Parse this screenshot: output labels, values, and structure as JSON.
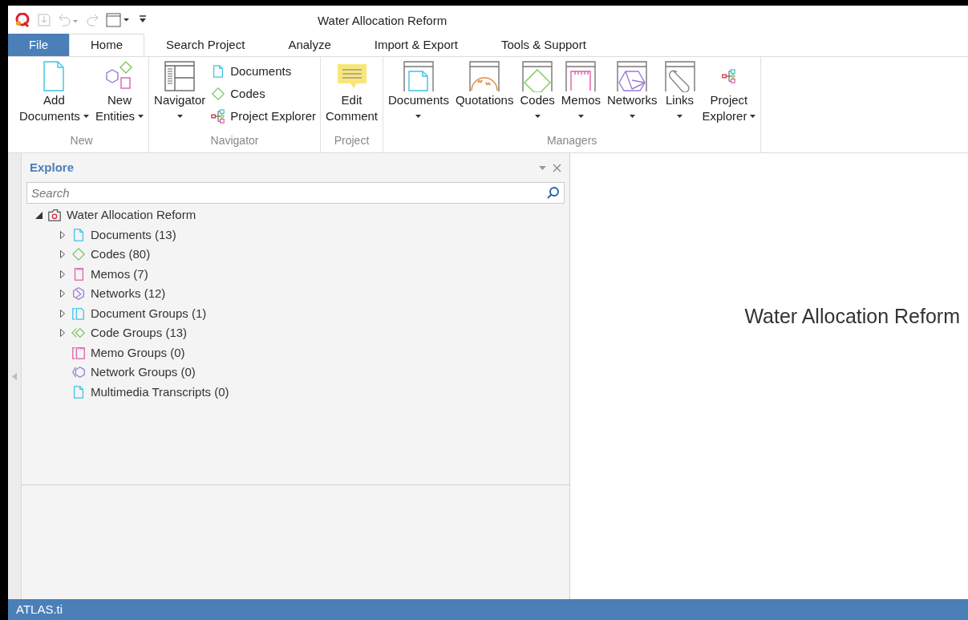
{
  "window": {
    "title": "Water Allocation Reform"
  },
  "tabs": [
    {
      "label": "File",
      "kind": "file",
      "selected": false
    },
    {
      "label": "Home",
      "kind": "tab",
      "selected": true
    },
    {
      "label": "Search Project",
      "kind": "tab",
      "selected": false
    },
    {
      "label": "Analyze",
      "kind": "tab",
      "selected": false
    },
    {
      "label": "Import & Export",
      "kind": "tab",
      "selected": false
    },
    {
      "label": "Tools & Support",
      "kind": "tab",
      "selected": false
    }
  ],
  "ribbon_groups": [
    {
      "name": "New",
      "buttons": [
        {
          "kind": "document",
          "lines": [
            "Add",
            "Documents"
          ],
          "dropdown": true
        },
        {
          "kind": "entities",
          "lines": [
            "New",
            "Entities"
          ],
          "dropdown": true
        }
      ]
    },
    {
      "name": "Navigator",
      "buttons": [
        {
          "kind": "navigator",
          "lines": [
            "Navigator"
          ],
          "dropdown": true
        },
        {
          "kind": "stack",
          "items": [
            {
              "kind": "document",
              "label": "Documents"
            },
            {
              "kind": "code",
              "label": "Codes"
            },
            {
              "kind": "explorer",
              "label": "Project Explorer"
            }
          ]
        }
      ]
    },
    {
      "name": "Project",
      "buttons": [
        {
          "kind": "comment",
          "lines": [
            "Edit",
            "Comment"
          ],
          "dropdown": false
        }
      ]
    },
    {
      "name": "Managers",
      "buttons": [
        {
          "kind": "mgr-document",
          "lines": [
            "Documents"
          ],
          "dropdown": true
        },
        {
          "kind": "mgr-quotation",
          "lines": [
            "Quotations"
          ],
          "dropdown": false
        },
        {
          "kind": "mgr-code",
          "lines": [
            "Codes"
          ],
          "dropdown": true
        },
        {
          "kind": "mgr-memo",
          "lines": [
            "Memos"
          ],
          "dropdown": true
        },
        {
          "kind": "mgr-network",
          "lines": [
            "Networks"
          ],
          "dropdown": true
        },
        {
          "kind": "mgr-link",
          "lines": [
            "Links"
          ],
          "dropdown": true
        },
        {
          "kind": "explorer",
          "lines": [
            "Project",
            "Explorer"
          ],
          "dropdown": true
        }
      ]
    }
  ],
  "explore": {
    "title": "Explore",
    "search": {
      "placeholder": "Search"
    },
    "tree": [
      {
        "label": "Water Allocation Reform",
        "kind": "project",
        "expandable": true,
        "expanded": true,
        "children": [
          {
            "label": "Documents (13)",
            "kind": "document",
            "expandable": true,
            "expanded": false
          },
          {
            "label": "Codes (80)",
            "kind": "code",
            "expandable": true,
            "expanded": false
          },
          {
            "label": "Memos (7)",
            "kind": "memo",
            "expandable": true,
            "expanded": false
          },
          {
            "label": "Networks (12)",
            "kind": "network",
            "expandable": true,
            "expanded": false
          },
          {
            "label": "Document Groups (1)",
            "kind": "document-group",
            "expandable": true,
            "expanded": false
          },
          {
            "label": "Code Groups (13)",
            "kind": "code-group",
            "expandable": true,
            "expanded": false
          },
          {
            "label": "Memo Groups (0)",
            "kind": "memo-group",
            "expandable": false,
            "expanded": false
          },
          {
            "label": "Network Groups (0)",
            "kind": "network-group",
            "expandable": false,
            "expanded": false
          },
          {
            "label": "Multimedia Transcripts (0)",
            "kind": "document",
            "expandable": false,
            "expanded": false
          }
        ]
      }
    ]
  },
  "main": {
    "heading": "Water Allocation Reform"
  },
  "status_bar": {
    "text": "ATLAS.ti"
  }
}
